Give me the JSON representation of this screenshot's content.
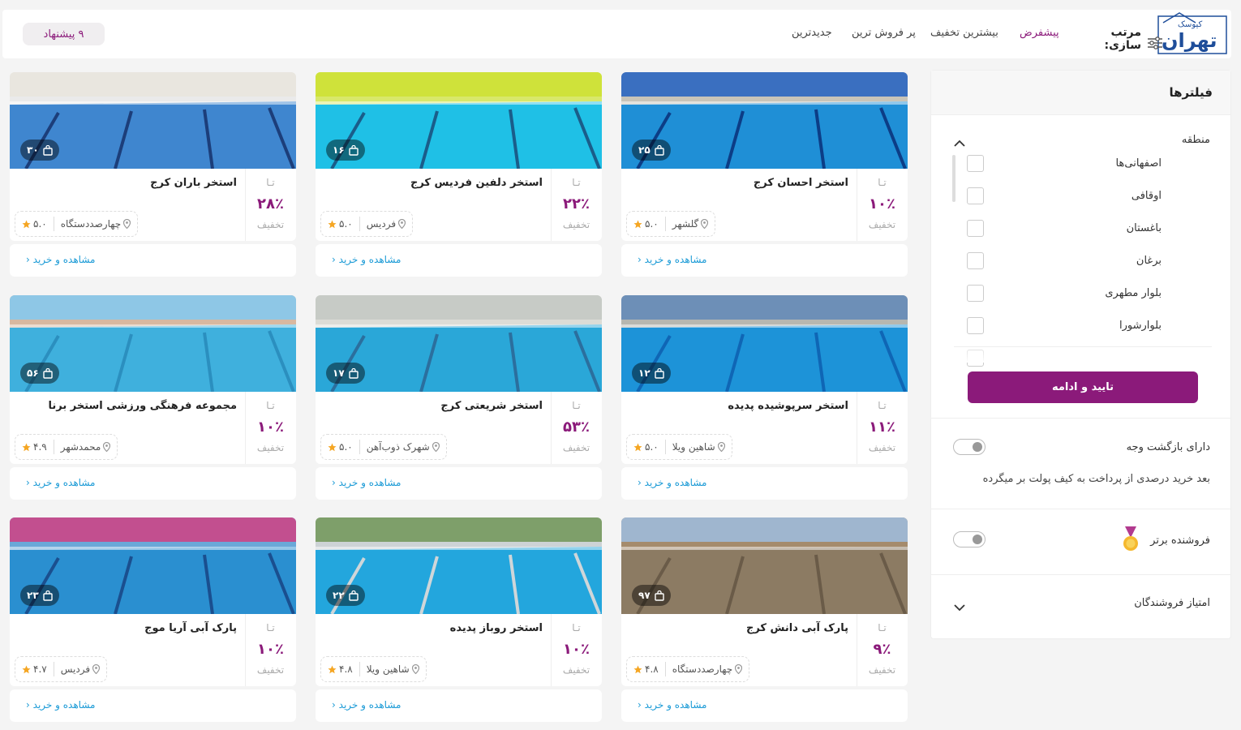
{
  "header": {
    "logo_text_small": "کیوسک",
    "logo_text_main": "تهران",
    "sort_label": "مرتب سازی:",
    "sort_options": [
      "پیشفرض",
      "بیشترین تخفیف",
      "پر فروش ترین",
      "جدیدترین"
    ],
    "offers_badge": "۹ پیشنهاد"
  },
  "common": {
    "upto": "تـا",
    "discount_word": "تخفیف",
    "buy_link": "مشاهده و خرید"
  },
  "cards": [
    {
      "title": "استخر احسان کرج",
      "discount": "۱۰٪",
      "sold": "۲۵",
      "location": "گلشهر",
      "rating": "۵.۰"
    },
    {
      "title": "استخر دلفین فردیس کرج",
      "discount": "۲۲٪",
      "sold": "۱۶",
      "location": "فردیس",
      "rating": "۵.۰"
    },
    {
      "title": "استخر باران کرج",
      "discount": "۲۸٪",
      "sold": "۳۰",
      "location": "چهارصددستگاه",
      "rating": "۵.۰"
    },
    {
      "title": "استخر سرپوشیده پدیده",
      "discount": "۱۱٪",
      "sold": "۱۲",
      "location": "شاهین ویلا",
      "rating": "۵.۰"
    },
    {
      "title": "استخر شریعتی کرج",
      "discount": "۵۳٪",
      "sold": "۱۷",
      "location": "شهرک ذوب‌آهن",
      "rating": "۵.۰"
    },
    {
      "title": "مجموعه فرهنگی ورزشی استخر برنا",
      "discount": "۱۰٪",
      "sold": "۵۶",
      "location": "محمدشهر",
      "rating": "۴.۹"
    },
    {
      "title": "پارک آبی دانش کرج",
      "discount": "۹٪",
      "sold": "۹۷",
      "location": "چهارصددستگاه",
      "rating": "۴.۸"
    },
    {
      "title": "استخر روباز پدیده",
      "discount": "۱۰٪",
      "sold": "۲۲",
      "location": "شاهین ویلا",
      "rating": "۴.۸"
    },
    {
      "title": "پارک آبی آریا موج",
      "discount": "۱۰٪",
      "sold": "۲۳",
      "location": "فردیس",
      "rating": "۴.۷"
    }
  ],
  "sidebar": {
    "title": "فیلترها",
    "region_title": "منطقه",
    "regions": [
      "اصفهانی‌ها",
      "اوقافی",
      "باغستان",
      "برغان",
      "بلوار مطهری",
      "بلوارشورا"
    ],
    "confirm_button": "تایید و ادامه",
    "cashback_label": "دارای بازگشت وجه",
    "cashback_desc": "بعد خرید درصدی از پرداخت به کیف پولت بر میگرده",
    "top_seller_label": "فروشنده برتر",
    "seller_rating_label": "امتیاز فروشندگان"
  },
  "colors": {
    "accent": "#8b1a7a",
    "link": "#1a9ad6",
    "star": "#f5a623"
  }
}
